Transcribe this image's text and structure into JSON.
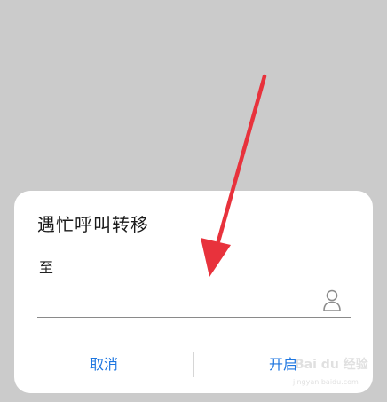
{
  "dialog": {
    "title": "遇忙呼叫转移",
    "field_label": "至",
    "input_value": "",
    "input_placeholder": "",
    "contact_icon": "person-icon",
    "cancel_label": "取消",
    "enable_label": "开启"
  },
  "colors": {
    "backdrop": "#cbcbcb",
    "dialog_bg": "#ffffff",
    "accent": "#1d76e0",
    "arrow": "#e8323c"
  },
  "watermark": {
    "brand": "Bai du 经验",
    "url": "jingyan.baidu.com"
  }
}
